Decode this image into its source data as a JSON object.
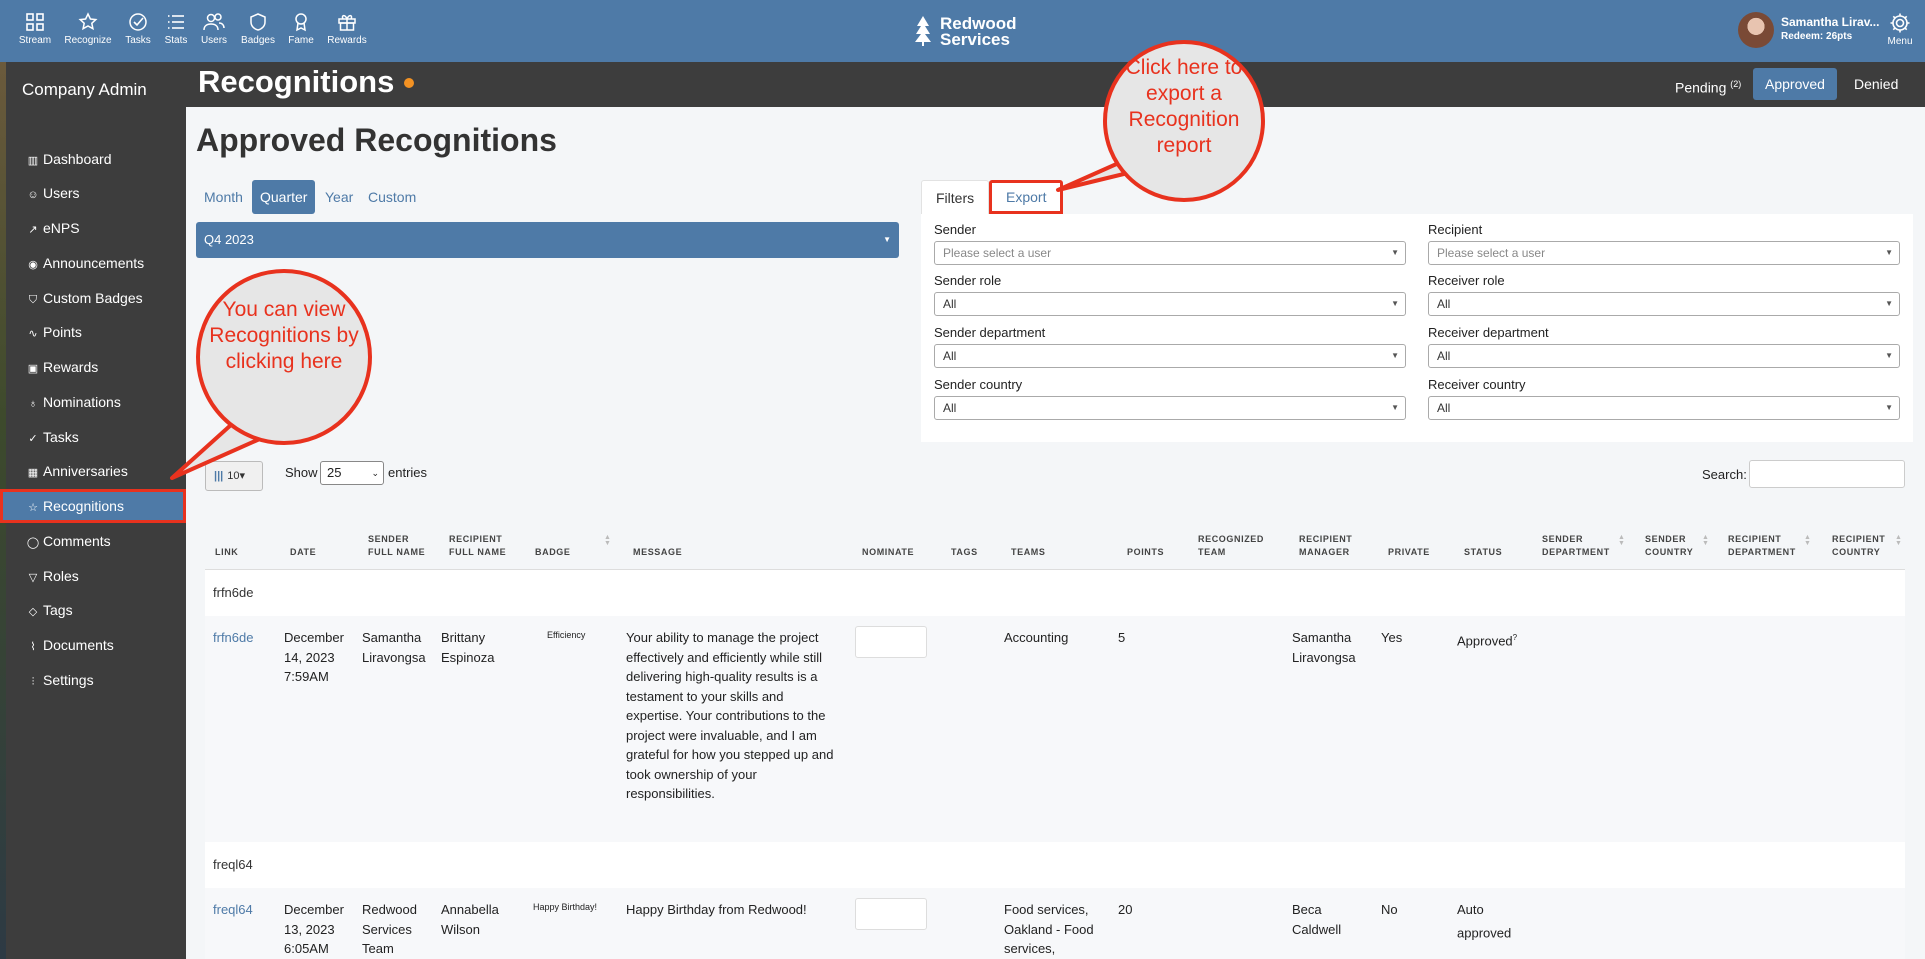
{
  "topnav": {
    "items": [
      {
        "label": "Stream",
        "icon": "grid-icon"
      },
      {
        "label": "Recognize",
        "icon": "star-icon"
      },
      {
        "label": "Tasks",
        "icon": "check-circle-icon"
      },
      {
        "label": "Stats",
        "icon": "list-icon"
      },
      {
        "label": "Users",
        "icon": "users-icon"
      },
      {
        "label": "Badges",
        "icon": "shield-icon"
      },
      {
        "label": "Fame",
        "icon": "award-icon"
      },
      {
        "label": "Rewards",
        "icon": "gift-icon"
      }
    ],
    "logo_line1": "Redwood",
    "logo_line2": "Services",
    "user_name": "Samantha Lirav...",
    "user_points": "Redeem: 26pts",
    "menu_label": "Menu"
  },
  "sidebar": {
    "title": "Company Admin",
    "items": [
      {
        "label": "Dashboard",
        "icon": "bar-chart-icon"
      },
      {
        "label": "Users",
        "icon": "user-icon"
      },
      {
        "label": "eNPS",
        "icon": "trend-icon"
      },
      {
        "label": "Announcements",
        "icon": "broadcast-icon"
      },
      {
        "label": "Custom Badges",
        "icon": "shield-icon"
      },
      {
        "label": "Points",
        "icon": "activity-icon"
      },
      {
        "label": "Rewards",
        "icon": "gift-icon"
      },
      {
        "label": "Nominations",
        "icon": "award-icon"
      },
      {
        "label": "Tasks",
        "icon": "check-circle-icon"
      },
      {
        "label": "Anniversaries",
        "icon": "calendar-icon"
      },
      {
        "label": "Recognitions",
        "icon": "star-icon"
      },
      {
        "label": "Comments",
        "icon": "comment-icon"
      },
      {
        "label": "Roles",
        "icon": "filter-icon"
      },
      {
        "label": "Tags",
        "icon": "tag-icon"
      },
      {
        "label": "Documents",
        "icon": "paperclip-icon"
      },
      {
        "label": "Settings",
        "icon": "sliders-icon"
      }
    ],
    "active_index": 10
  },
  "header": {
    "title": "Recognitions",
    "tabs": [
      {
        "label": "Pending",
        "count": "(2)"
      },
      {
        "label": "Approved",
        "count": ""
      },
      {
        "label": "Denied",
        "count": ""
      }
    ],
    "dot_color": "#f39223"
  },
  "main": {
    "heading": "Approved Recognitions",
    "period_tabs": [
      "Month",
      "Quarter",
      "Year",
      "Custom"
    ],
    "active_period": 1,
    "quarter_value": "Q4 2023",
    "filter_tabs": [
      "Filters",
      "Export"
    ],
    "filters": {
      "sender_label": "Sender",
      "sender_placeholder": "Please select a user",
      "recipient_label": "Recipient",
      "recipient_placeholder": "Please select a user",
      "sender_role_label": "Sender role",
      "sender_role_value": "All",
      "receiver_role_label": "Receiver role",
      "receiver_role_value": "All",
      "sender_dept_label": "Sender department",
      "sender_dept_value": "All",
      "receiver_dept_label": "Receiver department",
      "receiver_dept_value": "All",
      "sender_country_label": "Sender country",
      "sender_country_value": "All",
      "receiver_country_label": "Receiver country",
      "receiver_country_value": "All"
    },
    "column_button_count": "10",
    "show_label": "Show",
    "show_value": "25",
    "entries_label": "entries",
    "search_label": "Search:"
  },
  "table": {
    "headers": {
      "link": "Link",
      "date": "Date",
      "sender_full_name": "Sender Full Name",
      "recipient_full_name": "Recipient Full Name",
      "badge": "Badge",
      "message": "Message",
      "nominate": "Nominate",
      "tags": "Tags",
      "teams": "Teams",
      "points": "Points",
      "recognized_team": "Recognized Team",
      "recipient_manager": "Recipient Manager",
      "private": "Private",
      "status": "Status",
      "sender_department": "Sender Department",
      "sender_country": "Sender Country",
      "recipient_department": "Recipient Department",
      "recipient_country": "Recipient Country"
    },
    "rows": [
      {
        "group": "frfn6de",
        "link": "frfn6de",
        "date": "December 14, 2023 7:59AM",
        "sender": "Samantha Liravongsa",
        "recipient": "Brittany Espinoza",
        "badge": "Efficiency",
        "message": "Your ability to manage the project effectively and efficiently while still delivering high-quality results is a testament to your skills and expertise. Your contributions to the project were invaluable, and I am grateful for how you stepped up and took ownership of your responsibilities.",
        "teams": "Accounting",
        "points": "5",
        "recipient_manager": "Samantha Liravongsa",
        "private": "Yes",
        "status": "Approved",
        "status_sup": "?"
      },
      {
        "group": "freql64",
        "link": "freql64",
        "date": "December 13, 2023 6:05AM",
        "sender": "Redwood Services Team",
        "recipient": "Annabella Wilson",
        "badge": "Happy Birthday!",
        "message": "Happy Birthday from Redwood!",
        "teams": "Food services, Oakland - Food services,",
        "points": "20",
        "recipient_manager": "Beca Caldwell",
        "private": "No",
        "status": "Auto approved",
        "status_sup": ""
      }
    ]
  },
  "callouts": {
    "recognitions": "You can view Recognitions by clicking here",
    "export": "Click here to export a Recognition report",
    "color": "#e8321e"
  },
  "colors": {
    "primary": "#4e7aa7",
    "sidebar": "#3d3d3d",
    "accent_red": "#e8321e"
  }
}
